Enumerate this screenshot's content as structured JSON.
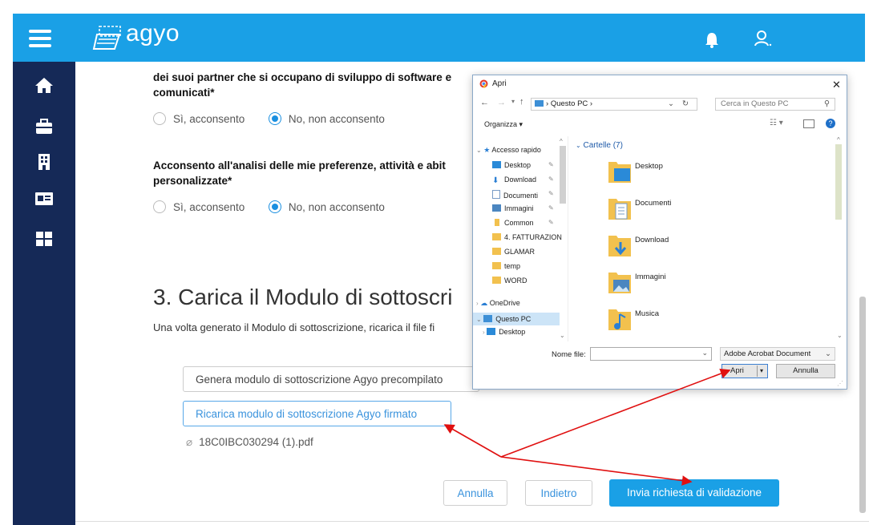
{
  "header": {
    "brand": "agyo",
    "brand_color": "#1aa0e6",
    "icons": [
      "menu-icon",
      "bell-icon",
      "user-icon"
    ]
  },
  "sidebar": {
    "color": "#152957",
    "icons": [
      "home-icon",
      "briefcase-icon",
      "building-icon",
      "id-card-icon",
      "grid-icon"
    ]
  },
  "form": {
    "q1_line1": "dei suoi partner che si occupano di sviluppo di software e",
    "q1_line2": "comunicati*",
    "q2_line1": "Acconsento all'analisi delle mie preferenze, attività e abit",
    "q2_line2": "personalizzate*",
    "opt_yes": "Sì, acconsento",
    "opt_no": "No, non acconsento",
    "section_title": "3. Carica il Modulo di sottoscri",
    "section_text": "Una volta generato il Modulo di sottoscrizione, ricarica il file fi",
    "generate_button": "Genera modulo di sottoscrizione Agyo precompilato",
    "upload_button": "Ricarica modulo di sottoscrizione Agyo firmato",
    "attached_file": "18C0IBC030294 (1).pdf",
    "cancel_button": "Annulla",
    "back_button": "Indietro",
    "submit_button": "Invia richiesta di validazione"
  },
  "dialog": {
    "title": "Apri",
    "close": "✕",
    "address": "Questo PC",
    "search_placeholder": "Cerca in Questo PC",
    "organize": "Organizza ▾",
    "quick_access": "Accesso rapido",
    "nav_items": [
      "Desktop",
      "Download",
      "Documenti",
      "Immagini",
      "Common",
      "4. FATTURAZION",
      "GLAMAR",
      "temp",
      "WORD"
    ],
    "onedrive": "OneDrive",
    "this_pc": "Questo PC",
    "desktop_sub": "Desktop",
    "folders_header": "Cartelle (7)",
    "folders": [
      "Desktop",
      "Documenti",
      "Download",
      "Immagini",
      "Musica"
    ],
    "filename_label": "Nome file:",
    "filetype": "Adobe Acrobat Document",
    "open_button": "Apri",
    "cancel_button": "Annulla"
  }
}
